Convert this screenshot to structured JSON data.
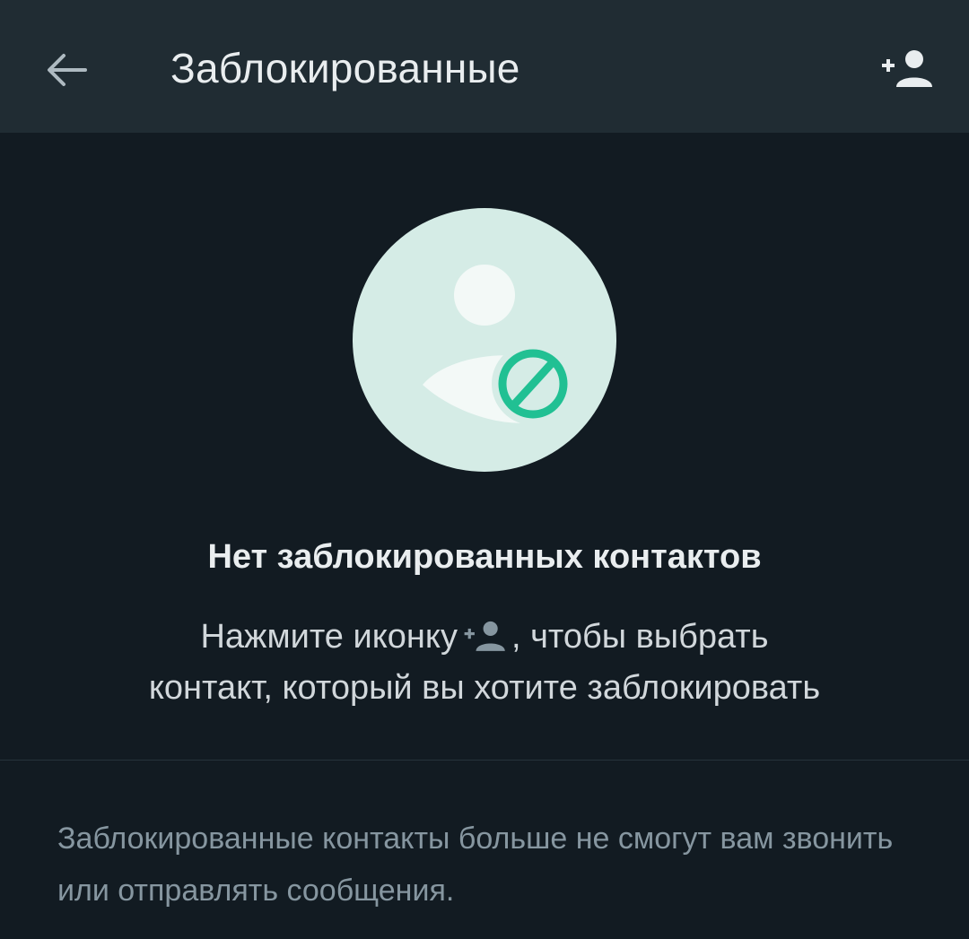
{
  "header": {
    "back_icon": "arrow-left-icon",
    "title": "Заблокированные",
    "add_icon": "person-add-icon"
  },
  "empty_state": {
    "illustration_icon": "blocked-person-icon",
    "title": "Нет заблокированных контактов",
    "hint_before": "Нажмите иконку",
    "hint_inline_icon": "person-add-icon",
    "hint_line1_after": ", чтобы выбрать",
    "hint_line2": "контакт, который вы хотите заблокировать"
  },
  "footer": {
    "note": "Заблокированные контакты больше не смогут вам звонить или отправлять сообщения."
  },
  "colors": {
    "toolbar_bg": "#202c33",
    "background": "#121b22",
    "accent": "#21c093",
    "hero_circle": "#d5ece6"
  }
}
